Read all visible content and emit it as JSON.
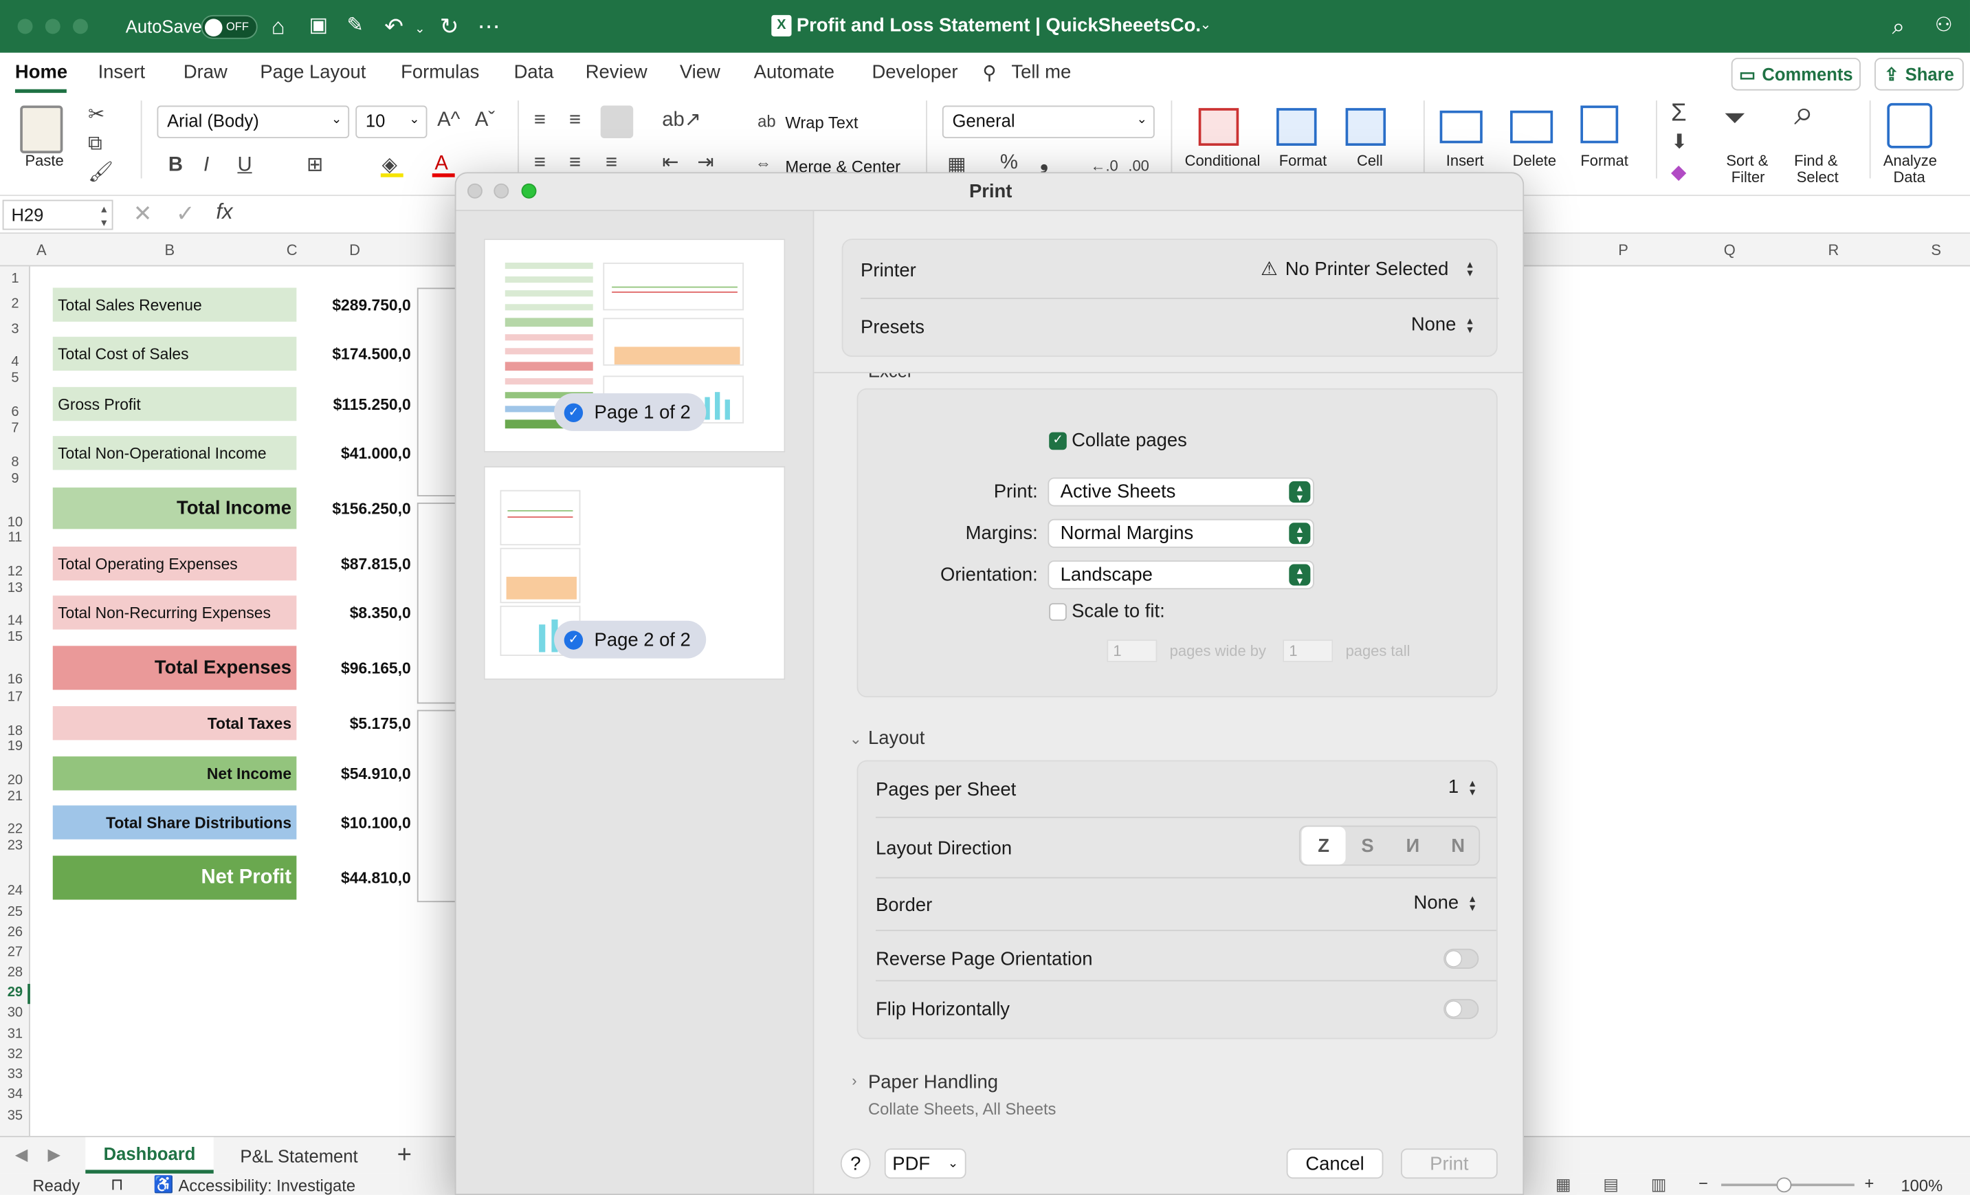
{
  "titlebar": {
    "autosave_label": "AutoSave",
    "autosave_state": "OFF",
    "doc_title": "Profit and Loss Statement | QuickSheeetsCo."
  },
  "menu": {
    "tabs": [
      "Home",
      "Insert",
      "Draw",
      "Page Layout",
      "Formulas",
      "Data",
      "Review",
      "View",
      "Automate",
      "Developer"
    ],
    "tell_me": "Tell me",
    "comments": "Comments",
    "share": "Share"
  },
  "ribbon": {
    "paste": "Paste",
    "font_name": "Arial (Body)",
    "font_size": "10",
    "wrap_text": "Wrap Text",
    "merge_center": "Merge & Center",
    "number_format": "General",
    "conditional": "Conditional",
    "format_as": "Format",
    "cell": "Cell",
    "insert": "Insert",
    "delete": "Delete",
    "format": "Format",
    "sort_filter_1": "Sort &",
    "sort_filter_2": "Filter",
    "find_select_1": "Find &",
    "find_select_2": "Select",
    "analyze_1": "Analyze",
    "analyze_2": "Data"
  },
  "formula_bar": {
    "name_box": "H29",
    "fx": "fx"
  },
  "columns": [
    "A",
    "B",
    "C",
    "D",
    "P",
    "Q",
    "R",
    "S"
  ],
  "rows": [
    "1",
    "2",
    "3",
    "4",
    "5",
    "6",
    "7",
    "8",
    "9",
    "10",
    "11",
    "12",
    "13",
    "14",
    "15",
    "16",
    "17",
    "18",
    "19",
    "20",
    "21",
    "22",
    "23",
    "24",
    "25",
    "26",
    "27",
    "28",
    "29",
    "30",
    "31",
    "32",
    "33",
    "34",
    "35"
  ],
  "sheet": {
    "items": [
      {
        "label": "Total Sales Revenue",
        "value": "$289.750,0",
        "bg": "#d9ead3",
        "align": "left",
        "bold": false
      },
      {
        "label": "Total Cost of Sales",
        "value": "$174.500,0",
        "bg": "#d9ead3",
        "align": "left",
        "bold": false
      },
      {
        "label": "Gross Profit",
        "value": "$115.250,0",
        "bg": "#d9ead3",
        "align": "left",
        "bold": false
      },
      {
        "label": "Total Non-Operational Income",
        "value": "$41.000,0",
        "bg": "#d9ead3",
        "align": "left",
        "bold": false
      },
      {
        "label": "Total Income",
        "value": "$156.250,0",
        "bg": "#b6d7a8",
        "align": "right",
        "bold": true
      },
      {
        "label": "Total Operating Expenses",
        "value": "$87.815,0",
        "bg": "#f4cccc",
        "align": "left",
        "bold": false
      },
      {
        "label": "Total Non-Recurring Expenses",
        "value": "$8.350,0",
        "bg": "#f4cccc",
        "align": "left",
        "bold": false
      },
      {
        "label": "Total Expenses",
        "value": "$96.165,0",
        "bg": "#ea9999",
        "align": "right",
        "bold": true
      },
      {
        "label": "Total Taxes",
        "value": "$5.175,0",
        "bg": "#f4cccc",
        "align": "right",
        "bold": true
      },
      {
        "label": "Net Income",
        "value": "$54.910,0",
        "bg": "#93c47d",
        "align": "right",
        "bold": true
      },
      {
        "label": "Total Share Distributions",
        "value": "$10.100,0",
        "bg": "#9fc5e8",
        "align": "right",
        "bold": true
      },
      {
        "label": "Net Profit",
        "value": "$44.810,0",
        "bg": "#6aa84f",
        "align": "right",
        "bold": true
      }
    ]
  },
  "sheet_tabs": [
    "Dashboard",
    "P&L Statement"
  ],
  "status": {
    "ready": "Ready",
    "accessibility": "Accessibility: Investigate",
    "zoom": "100%"
  },
  "dialog": {
    "title": "Print",
    "pages": [
      "Page 1 of 2",
      "Page 2 of 2"
    ],
    "printer_label": "Printer",
    "printer_value": "No Printer Selected",
    "presets_label": "Presets",
    "presets_value": "None",
    "excel_section": "Excel",
    "collate_pages": "Collate pages",
    "print_label": "Print:",
    "print_value": "Active Sheets",
    "margins_label": "Margins:",
    "margins_value": "Normal Margins",
    "orientation_label": "Orientation:",
    "orientation_value": "Landscape",
    "scale_to_fit": "Scale to fit:",
    "pages_wide_value": "1",
    "pages_wide_by": "pages wide by",
    "pages_tall_value": "1",
    "pages_tall": "pages tall",
    "layout_section": "Layout",
    "pages_per_sheet_label": "Pages per Sheet",
    "pages_per_sheet_value": "1",
    "layout_direction_label": "Layout Direction",
    "border_label": "Border",
    "border_value": "None",
    "reverse_orientation": "Reverse Page Orientation",
    "flip_horizontally": "Flip Horizontally",
    "paper_handling": "Paper Handling",
    "paper_handling_sub": "Collate Sheets, All Sheets",
    "help": "?",
    "pdf": "PDF",
    "cancel": "Cancel",
    "print_button": "Print"
  }
}
